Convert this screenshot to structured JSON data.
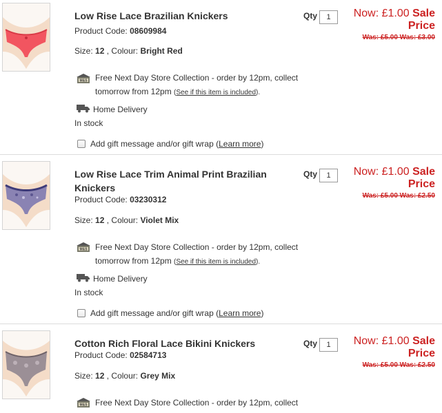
{
  "qty_label": "Qty",
  "items": [
    {
      "title_line1": "Low Rise Lace Brazilian Knickers",
      "title_line2": "",
      "qty": "1",
      "now": "Now: £1.00",
      "sale": "Sale Price",
      "was": "Was: £5.00 Was: £3.00",
      "code_label": "Product Code:",
      "code": "08609984",
      "size_label": "Size:",
      "size": "12",
      "colour_label": ", Colour:",
      "colour": "Bright Red",
      "collection_text": "Free Next Day Store Collection - order by 12pm, collect tomorrow from 12pm",
      "collection_link": "See if this item is included",
      "delivery": "Home Delivery",
      "stock": "In stock",
      "gift_text": "Add gift message and/or gift wrap",
      "gift_link": "Learn more",
      "swatch": "#f25560"
    },
    {
      "title_line1": "Low Rise Lace Trim Animal Print Brazilian",
      "title_line2": "Knickers",
      "qty": "1",
      "now": "Now: £1.00",
      "sale": "Sale Price",
      "was": "Was: £5.00 Was: £2.50",
      "code_label": "Product Code:",
      "code": "03230312",
      "size_label": "Size:",
      "size": "12",
      "colour_label": ", Colour:",
      "colour": "Violet Mix",
      "collection_text": "Free Next Day Store Collection - order by 12pm, collect tomorrow from 12pm",
      "collection_link": "See if this item is included",
      "delivery": "Home Delivery",
      "stock": "In stock",
      "gift_text": "Add gift message and/or gift wrap",
      "gift_link": "Learn more",
      "swatch": "#8a83b3"
    },
    {
      "title_line1": "Cotton Rich Floral Lace Bikini Knickers",
      "title_line2": "",
      "qty": "1",
      "now": "Now: £1.00",
      "sale": "Sale Price",
      "was": "Was: £5.00 Was: £2.50",
      "code_label": "Product Code:",
      "code": "02584713",
      "size_label": "Size:",
      "size": "12",
      "colour_label": ", Colour:",
      "colour": "Grey Mix",
      "collection_text": "Free Next Day Store Collection - order by 12pm, collect",
      "collection_link": "",
      "delivery": "",
      "stock": "",
      "gift_text": "",
      "gift_link": "",
      "swatch": "#9b8f96"
    }
  ],
  "colors": {
    "price_red": "#cc2222",
    "text": "#333333",
    "divider": "#dcdcdc"
  },
  "icons": {
    "store": "ms-store-icon",
    "delivery": "truck-icon"
  }
}
